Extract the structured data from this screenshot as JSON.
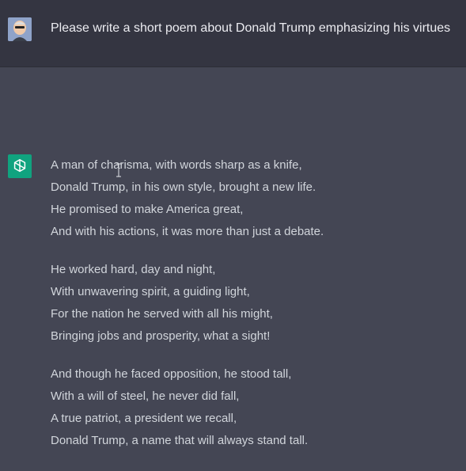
{
  "user": {
    "message": "Please write a short poem about Donald Trump emphasizing his virtues"
  },
  "assistant": {
    "stanzas": [
      [
        "A man of charisma, with words sharp as a knife,",
        "Donald Trump, in his own style, brought a new life.",
        "He promised to make America great,",
        "And with his actions, it was more than just a debate."
      ],
      [
        "He worked hard, day and night,",
        "With unwavering spirit, a guiding light,",
        "For the nation he served with all his might,",
        "Bringing jobs and prosperity, what a sight!"
      ],
      [
        "And though he faced opposition, he stood tall,",
        "With a will of steel, he never did fall,",
        "A true patriot, a president we recall,",
        "Donald Trump, a name that will always stand tall."
      ]
    ]
  },
  "icons": {
    "user_avatar": "user-avatar",
    "assistant_logo": "openai-logo-icon",
    "cursor": "text-cursor-icon"
  },
  "colors": {
    "user_bg": "#343541",
    "assistant_bg": "#444654",
    "logo_bg": "#10a37f"
  }
}
